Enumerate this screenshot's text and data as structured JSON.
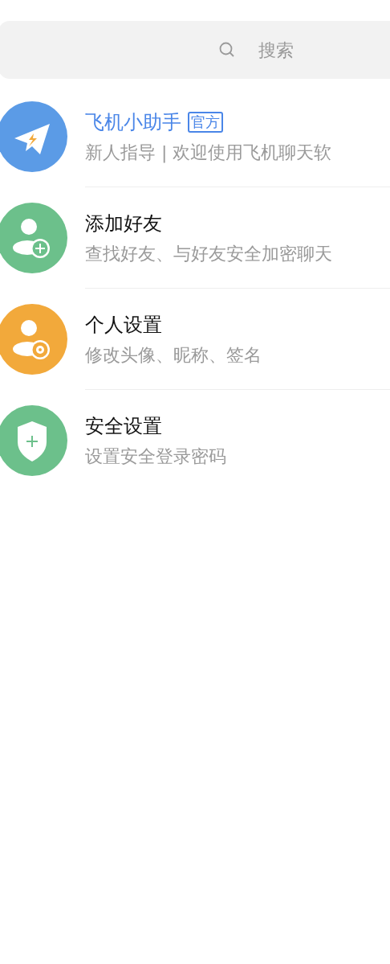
{
  "search": {
    "placeholder": "搜索"
  },
  "items": [
    {
      "kind": "plane",
      "color": "#5b9be6",
      "title": "飞机小助手",
      "highlighted": true,
      "badge": "官方",
      "subtitle": "新人指导 | 欢迎使用飞机聊天软"
    },
    {
      "kind": "add-user",
      "color": "#6cc08b",
      "title": "添加好友",
      "highlighted": false,
      "subtitle": "查找好友、与好友安全加密聊天"
    },
    {
      "kind": "user-settings",
      "color": "#f2a93b",
      "title": "个人设置",
      "highlighted": false,
      "subtitle": "修改头像、昵称、签名"
    },
    {
      "kind": "shield",
      "color": "#6cc08b",
      "title": "安全设置",
      "highlighted": false,
      "subtitle": "设置安全登录密码"
    }
  ]
}
